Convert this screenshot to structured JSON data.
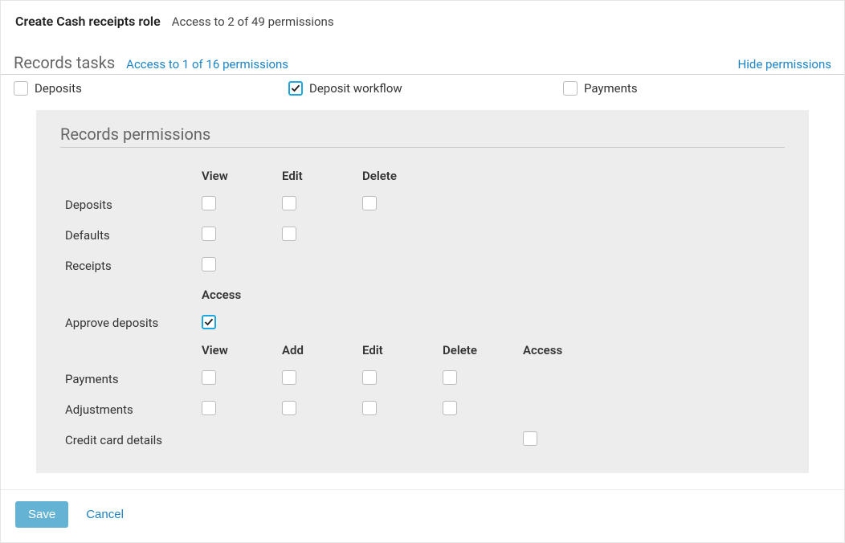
{
  "header": {
    "title": "Create Cash receipts role",
    "subtitle": "Access to 2 of 49 permissions"
  },
  "section": {
    "title": "Records tasks",
    "sub": "Access to 1 of 16 permissions",
    "hide_link": "Hide permissions"
  },
  "tasks": {
    "deposits": {
      "label": "Deposits",
      "checked": false
    },
    "workflow": {
      "label": "Deposit workflow",
      "checked": true
    },
    "payments": {
      "label": "Payments",
      "checked": false
    }
  },
  "perm_panel": {
    "title": "Records permissions",
    "cols1": {
      "c1": "View",
      "c2": "Edit",
      "c3": "Delete"
    },
    "rows1": {
      "deposits": {
        "label": "Deposits"
      },
      "defaults": {
        "label": "Defaults"
      },
      "receipts": {
        "label": "Receipts"
      }
    },
    "cols2": {
      "c1": "Access"
    },
    "rows2": {
      "approve": {
        "label": "Approve deposits",
        "checked": true
      }
    },
    "cols3": {
      "c1": "View",
      "c2": "Add",
      "c3": "Edit",
      "c4": "Delete",
      "c5": "Access"
    },
    "rows3": {
      "payments": {
        "label": "Payments"
      },
      "adjustments": {
        "label": "Adjustments"
      },
      "credit": {
        "label": "Credit card details"
      }
    }
  },
  "footer": {
    "save": "Save",
    "cancel": "Cancel"
  }
}
